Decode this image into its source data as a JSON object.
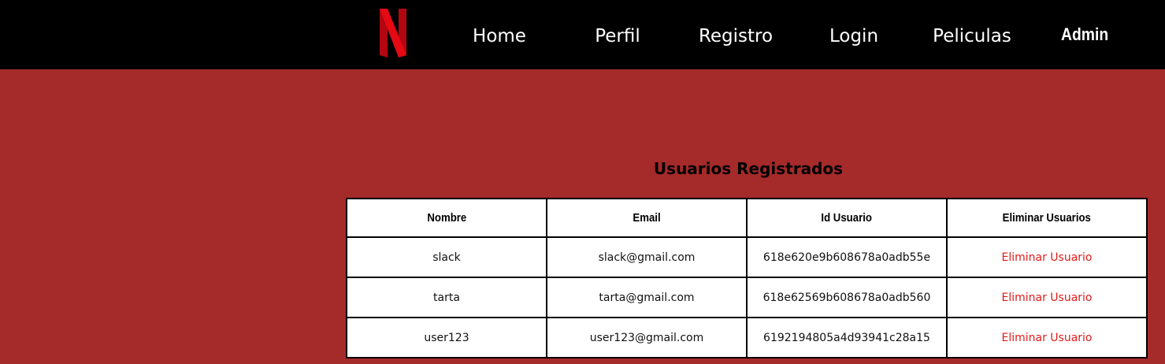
{
  "nav": {
    "links": [
      "Home",
      "Perfil",
      "Registro",
      "Login",
      "Peliculas"
    ],
    "admin_label": "Admin",
    "logo_color": "#e50914"
  },
  "main": {
    "title": "Usuarios Registrados",
    "table": {
      "headers": [
        "Nombre",
        "Email",
        "Id Usuario",
        "Eliminar Usuarios"
      ],
      "rows": [
        {
          "nombre": "slack",
          "email": "slack@gmail.com",
          "id": "618e620e9b608678a0adb55e",
          "action": "Eliminar Usuario"
        },
        {
          "nombre": "tarta",
          "email": "tarta@gmail.com",
          "id": "618e62569b608678a0adb560",
          "action": "Eliminar Usuario"
        },
        {
          "nombre": "user123",
          "email": "user123@gmail.com",
          "id": "6192194805a4d93941c28a15",
          "action": "Eliminar Usuario"
        }
      ]
    }
  },
  "colors": {
    "page_background": "#a52a2a",
    "navbar_background": "#000000",
    "delete_link": "#e21a1a"
  }
}
